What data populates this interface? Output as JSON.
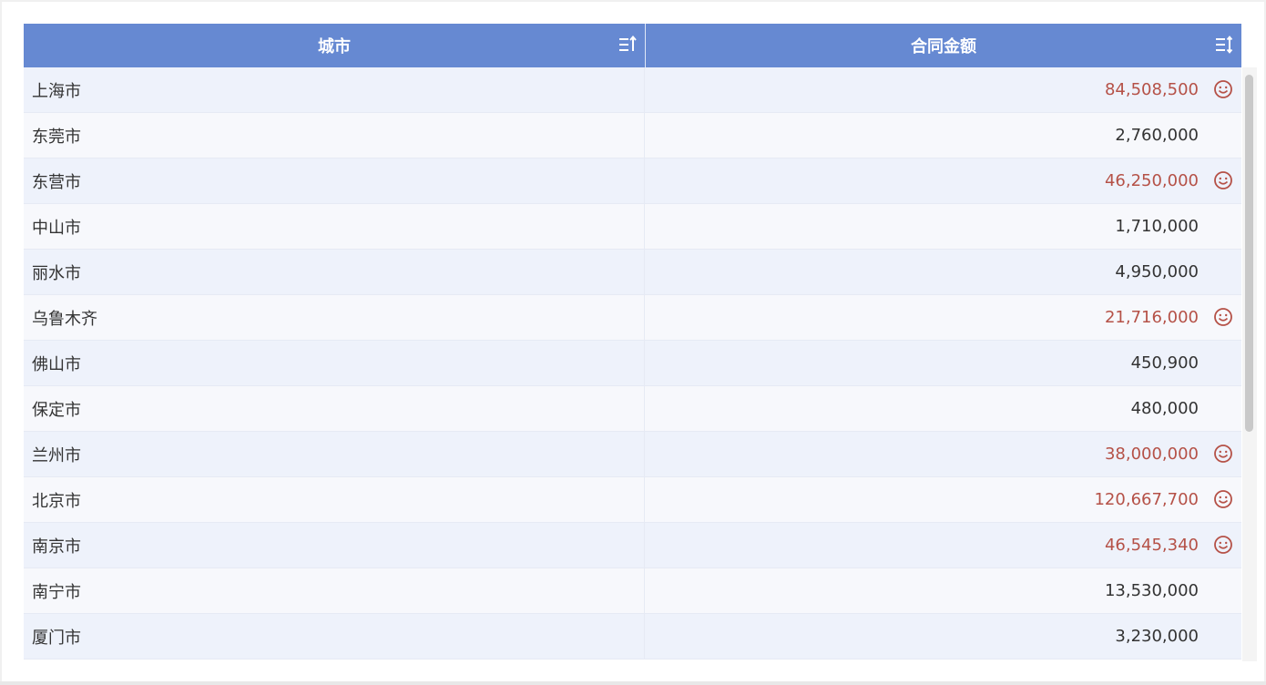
{
  "table": {
    "columns": [
      {
        "label": "城市",
        "sort_icon": "sort-ascending-icon"
      },
      {
        "label": "合同金额",
        "sort_icon": "sort-both-icon"
      }
    ],
    "rows": [
      {
        "city": "上海市",
        "amount": "84,508,500",
        "highlight": true
      },
      {
        "city": "东莞市",
        "amount": "2,760,000",
        "highlight": false
      },
      {
        "city": "东营市",
        "amount": "46,250,000",
        "highlight": true
      },
      {
        "city": "中山市",
        "amount": "1,710,000",
        "highlight": false
      },
      {
        "city": "丽水市",
        "amount": "4,950,000",
        "highlight": false
      },
      {
        "city": "乌鲁木齐",
        "amount": "21,716,000",
        "highlight": true
      },
      {
        "city": "佛山市",
        "amount": "450,900",
        "highlight": false
      },
      {
        "city": "保定市",
        "amount": "480,000",
        "highlight": false
      },
      {
        "city": "兰州市",
        "amount": "38,000,000",
        "highlight": true
      },
      {
        "city": "北京市",
        "amount": "120,667,700",
        "highlight": true
      },
      {
        "city": "南京市",
        "amount": "46,545,340",
        "highlight": true
      },
      {
        "city": "南宁市",
        "amount": "13,530,000",
        "highlight": false
      },
      {
        "city": "厦门市",
        "amount": "3,230,000",
        "highlight": false
      }
    ],
    "highlight_icon": "smiley-icon"
  },
  "colors": {
    "header_bg": "#6689d2",
    "highlight_text": "#b55147",
    "row_odd": "#eef2fb",
    "row_even": "#f7f8fc"
  }
}
